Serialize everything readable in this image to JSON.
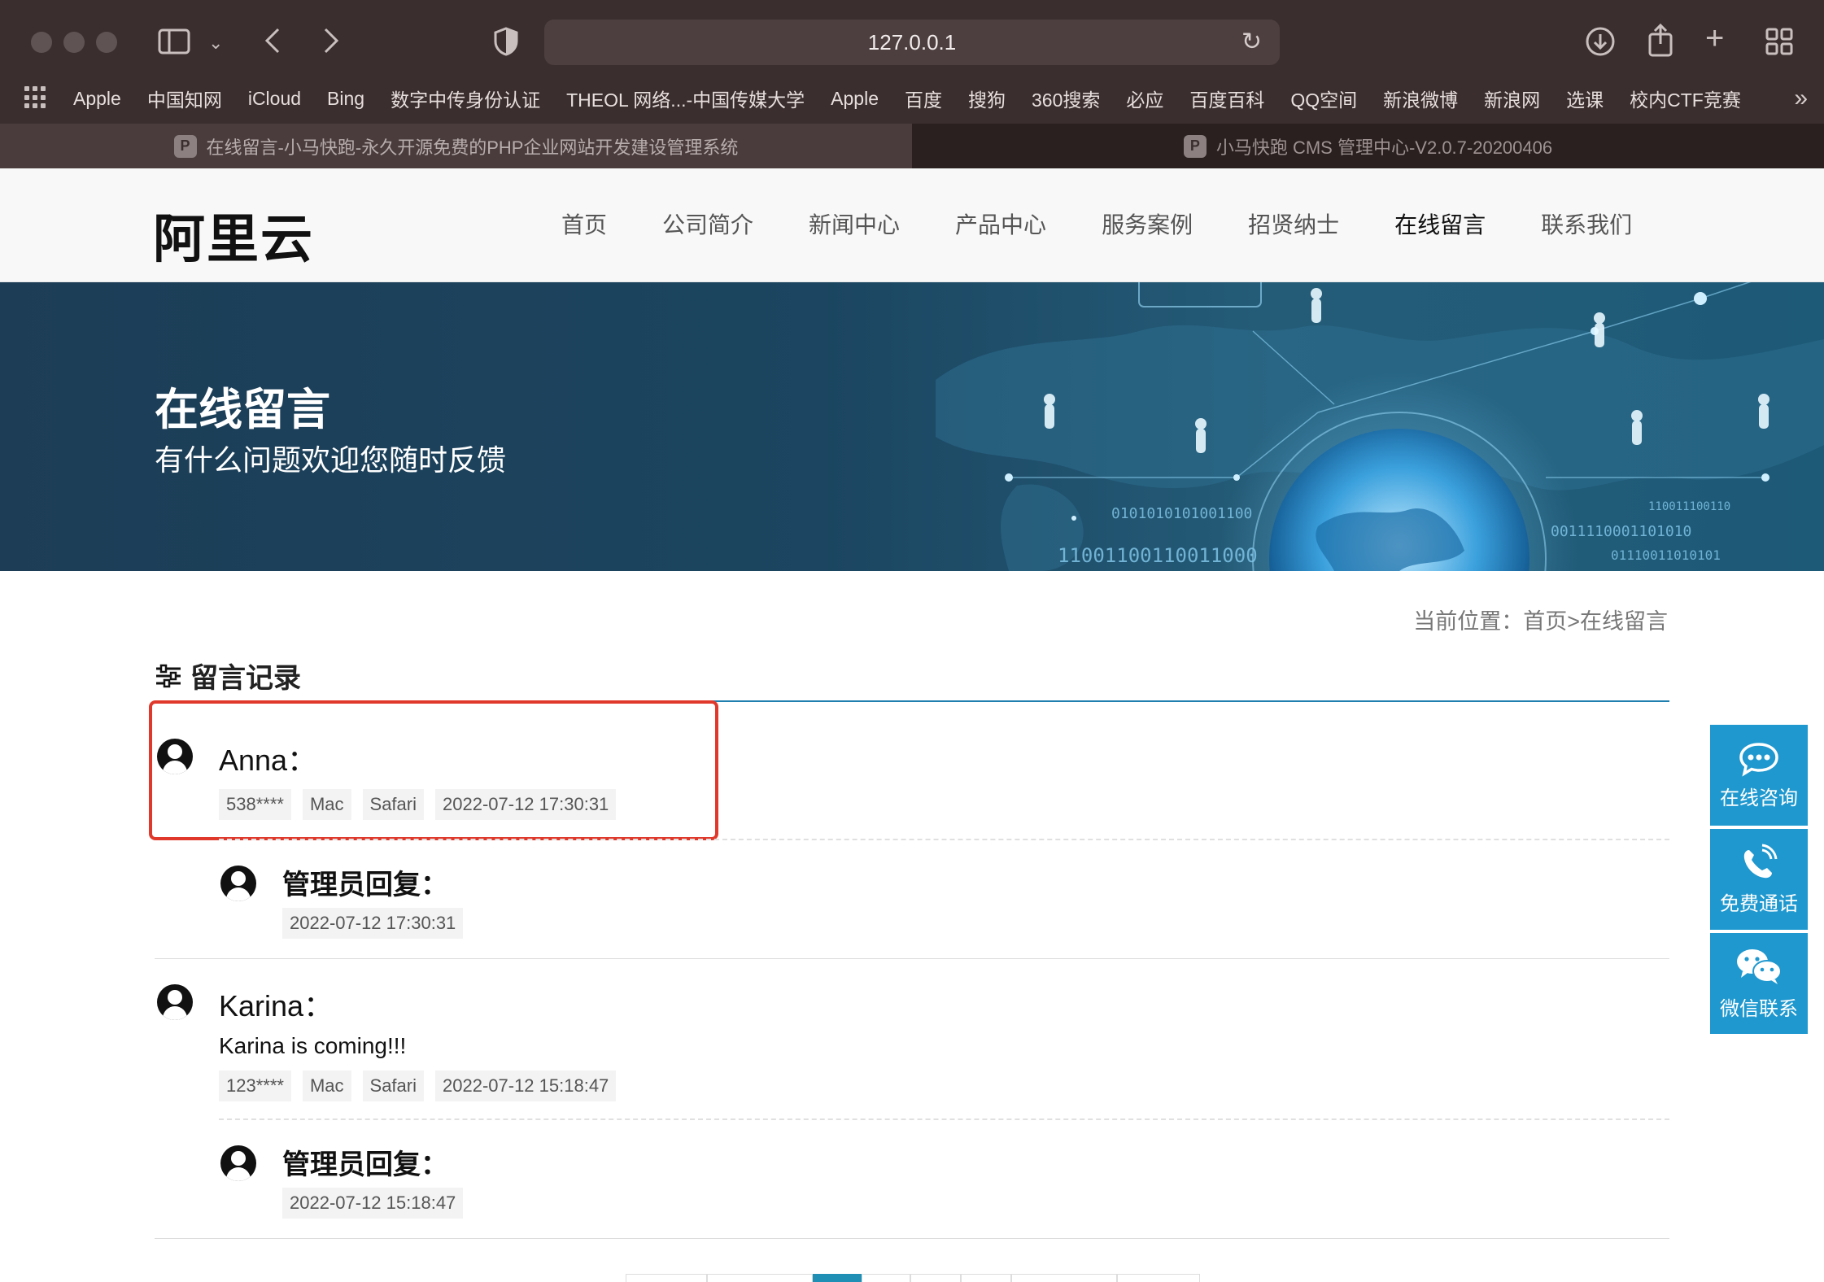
{
  "browser": {
    "url": "127.0.0.1",
    "bookmarks": [
      "Apple",
      "中国知网",
      "iCloud",
      "Bing",
      "数字中传身份认证",
      "THEOL 网络...-中国传媒大学",
      "Apple",
      "百度",
      "搜狗",
      "360搜索",
      "必应",
      "百度百科",
      "QQ空间",
      "新浪微博",
      "新浪网",
      "选课",
      "校内CTF竞赛"
    ],
    "tabs": [
      {
        "title": "在线留言-小马快跑-永久开源免费的PHP企业网站开发建设管理系统",
        "favicon": "P"
      },
      {
        "title": "小马快跑 CMS 管理中心-V2.0.7-20200406",
        "favicon": "P"
      }
    ],
    "icons": {
      "sidebar": "sidebar-icon",
      "back": "back-icon",
      "forward": "forward-icon",
      "shield": "shield-icon",
      "reload": "reload-icon",
      "download": "download-icon",
      "share": "share-icon",
      "new_tab": "plus-icon",
      "tab_overview": "grid-icon"
    }
  },
  "site": {
    "logo": "阿里云",
    "nav": [
      "首页",
      "公司简介",
      "新闻中心",
      "产品中心",
      "服务案例",
      "招贤纳士",
      "在线留言",
      "联系我们"
    ],
    "active_nav": "在线留言"
  },
  "banner": {
    "title": "在线留言",
    "subtitle": "有什么问题欢迎您随时反馈",
    "binary": [
      "0101010101001100",
      "11001100110011000",
      "0011110001101010",
      "01110011010101",
      "110011100110"
    ]
  },
  "breadcrumb": "当前位置：首页>在线留言",
  "section_title": "留言记录",
  "messages": [
    {
      "name": "Anna：",
      "content": "",
      "phone": "538****",
      "os": "Mac",
      "browser": "Safari",
      "time": "2022-07-12 17:30:31",
      "reply_label": "管理员回复：",
      "reply_time": "2022-07-12 17:30:31"
    },
    {
      "name": "Karina：",
      "content": "Karina is coming!!!",
      "phone": "123****",
      "os": "Mac",
      "browser": "Safari",
      "time": "2022-07-12 15:18:47",
      "reply_label": "管理员回复：",
      "reply_time": "2022-07-12 15:18:47"
    }
  ],
  "float_buttons": [
    {
      "label": "在线咨询",
      "icon": "chat-bubble-icon"
    },
    {
      "label": "免费通话",
      "icon": "phone-icon"
    },
    {
      "label": "微信联系",
      "icon": "wechat-icon"
    }
  ],
  "colors": {
    "accent": "#1f98cf",
    "highlight": "#e0392b",
    "rule": "#1f7fae"
  }
}
